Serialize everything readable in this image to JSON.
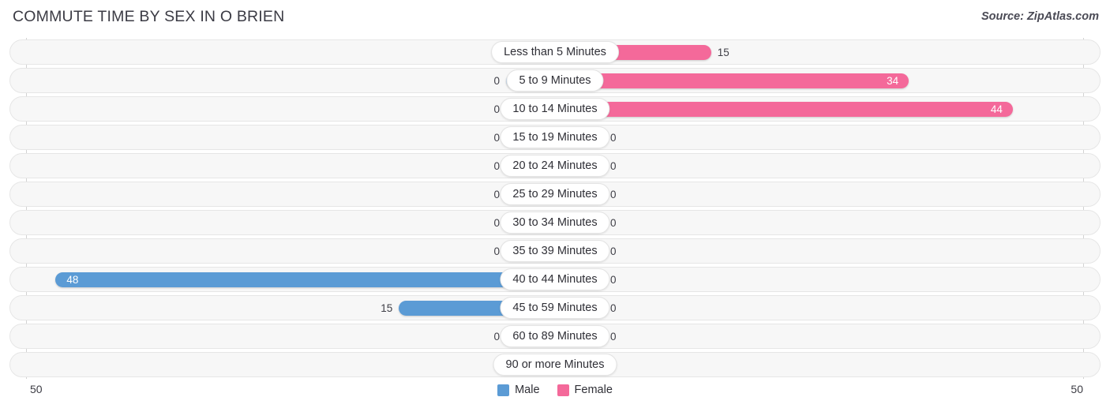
{
  "header": {
    "title": "COMMUTE TIME BY SEX IN O BRIEN",
    "source": "Source: ZipAtlas.com"
  },
  "axis": {
    "left_tick": "50",
    "right_tick": "50"
  },
  "legend": {
    "items": [
      {
        "label": "Male",
        "color": "#5b9bd5"
      },
      {
        "label": "Female",
        "color": "#f4699a"
      }
    ]
  },
  "colors": {
    "male_strong": "#5b9bd5",
    "male_light": "#a9c9e9",
    "female_strong": "#f4699a",
    "female_light": "#f7b0c9",
    "track": "#f7f7f7",
    "track_border": "#e6e6e6"
  },
  "chart_data": {
    "type": "bar",
    "title": "COMMUTE TIME BY SEX IN O BRIEN",
    "subtitle": "Source: ZipAtlas.com",
    "orientation": "horizontal",
    "layout": "diverging-bidirectional",
    "xlabel": "",
    "ylabel": "",
    "xlim": [
      -50,
      50
    ],
    "axis_max": 50,
    "grid": false,
    "legend_position": "bottom-center",
    "categories": [
      "Less than 5 Minutes",
      "5 to 9 Minutes",
      "10 to 14 Minutes",
      "15 to 19 Minutes",
      "20 to 24 Minutes",
      "25 to 29 Minutes",
      "30 to 34 Minutes",
      "35 to 39 Minutes",
      "40 to 44 Minutes",
      "45 to 59 Minutes",
      "60 to 89 Minutes",
      "90 or more Minutes"
    ],
    "series": [
      {
        "name": "Male",
        "side": "left",
        "color": "#5b9bd5",
        "values": [
          0,
          0,
          0,
          0,
          0,
          0,
          0,
          0,
          48,
          15,
          0,
          0
        ]
      },
      {
        "name": "Female",
        "side": "right",
        "color": "#f4699a",
        "values": [
          15,
          34,
          44,
          0,
          0,
          0,
          0,
          0,
          0,
          0,
          0,
          0
        ]
      }
    ]
  }
}
